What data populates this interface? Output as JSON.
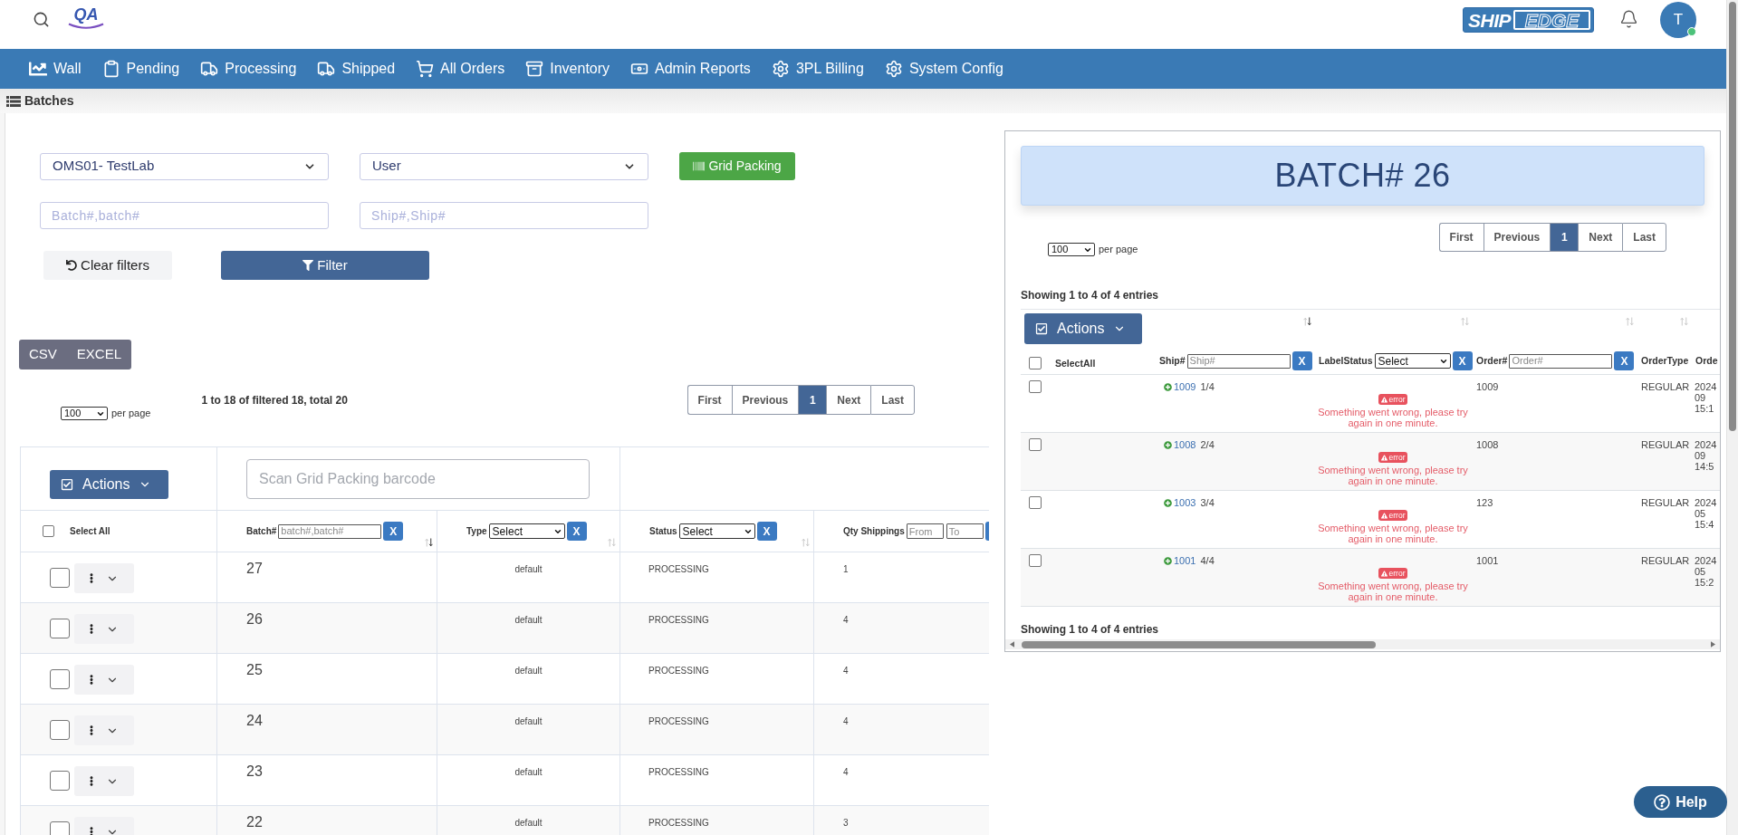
{
  "topbar": {
    "logo_text": "QA",
    "brand_logo": {
      "filled": "SHIP",
      "outlined": "EDGE"
    },
    "avatar": {
      "initial": "T",
      "online": true
    }
  },
  "nav": [
    {
      "label": "Wall"
    },
    {
      "label": "Pending"
    },
    {
      "label": "Processing"
    },
    {
      "label": "Shipped"
    },
    {
      "label": "All Orders"
    },
    {
      "label": "Inventory"
    },
    {
      "label": "Admin Reports"
    },
    {
      "label": "3PL Billing"
    },
    {
      "label": "System Config"
    }
  ],
  "page_title": "Batches",
  "filters": {
    "warehouse_select": "OMS01- TestLab",
    "user_select": "User",
    "grid_packing_button": "Grid Packing",
    "batch_field": {
      "placeholder": "Batch#,batch#"
    },
    "ship_field": {
      "placeholder": "Ship#,Ship#"
    },
    "clear_button": "Clear filters",
    "filter_button": "Filter"
  },
  "export_buttons": [
    "CSV",
    "EXCEL"
  ],
  "listing": {
    "per_page": {
      "value": "100",
      "label": "per page"
    },
    "summary": "1 to 18 of filtered 18, total 20",
    "pagination": [
      {
        "label": "First",
        "selected": false
      },
      {
        "label": "Previous",
        "selected": false
      },
      {
        "label": "1",
        "selected": true
      },
      {
        "label": "Next",
        "selected": false
      },
      {
        "label": "Last",
        "selected": false
      }
    ]
  },
  "batches_table": {
    "actions_button": "Actions",
    "scan_field": {
      "placeholder": "Scan Grid Packing barcode"
    },
    "select_all": {
      "label": "Select All",
      "checked": false
    },
    "columns": [
      {
        "kind": "text-filter",
        "label": "Batch#",
        "placeholder": "batch#,batch#",
        "clear": "X",
        "sorted": true
      },
      {
        "kind": "select-filter",
        "label": "Type",
        "value": "Select",
        "clear": "X",
        "sorted": false
      },
      {
        "kind": "select-filter",
        "label": "Status",
        "value": "Select",
        "clear": "X",
        "sorted": false
      },
      {
        "kind": "range-filter",
        "label": "Qty Shippings",
        "from_placeholder": "From",
        "to_placeholder": "To"
      }
    ],
    "rows": [
      {
        "checked": false,
        "batch": "27",
        "type": "default",
        "status": "PROCESSING",
        "qty": "1"
      },
      {
        "checked": false,
        "batch": "26",
        "type": "default",
        "status": "PROCESSING",
        "qty": "4"
      },
      {
        "checked": false,
        "batch": "25",
        "type": "default",
        "status": "PROCESSING",
        "qty": "4"
      },
      {
        "checked": false,
        "batch": "24",
        "type": "default",
        "status": "PROCESSING",
        "qty": "4"
      },
      {
        "checked": false,
        "batch": "23",
        "type": "default",
        "status": "PROCESSING",
        "qty": "4"
      },
      {
        "checked": false,
        "batch": "22",
        "type": "default",
        "status": "PROCESSING",
        "qty": "3"
      }
    ]
  },
  "batch_panel": {
    "title": "BATCH# 26",
    "per_page": {
      "value": "100",
      "label": "per page"
    },
    "pagination": [
      {
        "label": "First",
        "selected": false
      },
      {
        "label": "Previous",
        "selected": false
      },
      {
        "label": "1",
        "selected": true
      },
      {
        "label": "Next",
        "selected": false
      },
      {
        "label": "Last",
        "selected": false
      }
    ],
    "summary_top": "Showing 1 to 4 of 4 entries",
    "actions_button": "Actions",
    "select_all": {
      "label": "SelectAll",
      "checked": false
    },
    "columns": [
      {
        "kind": "text-filter",
        "label": "Ship#",
        "placeholder": "Ship#",
        "clear": "X",
        "sorted": true
      },
      {
        "kind": "select-filter",
        "label": "LabelStatus",
        "value": "Select",
        "clear": "X",
        "sorted": false
      },
      {
        "kind": "text-filter",
        "label": "Order#",
        "placeholder": "Order#",
        "clear": "X",
        "sorted": false
      },
      {
        "kind": "plain",
        "label": "OrderType",
        "sorted": false
      },
      {
        "kind": "plain",
        "label": "Orde"
      }
    ],
    "rows": [
      {
        "checked": false,
        "ship": "1009",
        "position": "1/4",
        "label_status": {
          "badge": "error",
          "message": "Something went wrong, please try again in one minute."
        },
        "order": "1009",
        "order_type": "REGULAR",
        "column_6": [
          "2024",
          "09",
          "15:1"
        ]
      },
      {
        "checked": false,
        "ship": "1008",
        "position": "2/4",
        "label_status": {
          "badge": "error",
          "message": "Something went wrong, please try again in one minute."
        },
        "order": "1008",
        "order_type": "REGULAR",
        "column_6": [
          "2024",
          "09",
          "14:5"
        ]
      },
      {
        "checked": false,
        "ship": "1003",
        "position": "3/4",
        "label_status": {
          "badge": "error",
          "message": "Something went wrong, please try again in one minute."
        },
        "order": "123",
        "order_type": "REGULAR",
        "column_6": [
          "2024",
          "05",
          "15:4"
        ]
      },
      {
        "checked": false,
        "ship": "1001",
        "position": "4/4",
        "label_status": {
          "badge": "error",
          "message": "Something went wrong, please try again in one minute."
        },
        "order": "1001",
        "order_type": "REGULAR",
        "column_6": [
          "2024",
          "05",
          "15:2"
        ]
      }
    ],
    "summary_bottom": "Showing 1 to 4 of 4 entries"
  },
  "help_button": "Help"
}
